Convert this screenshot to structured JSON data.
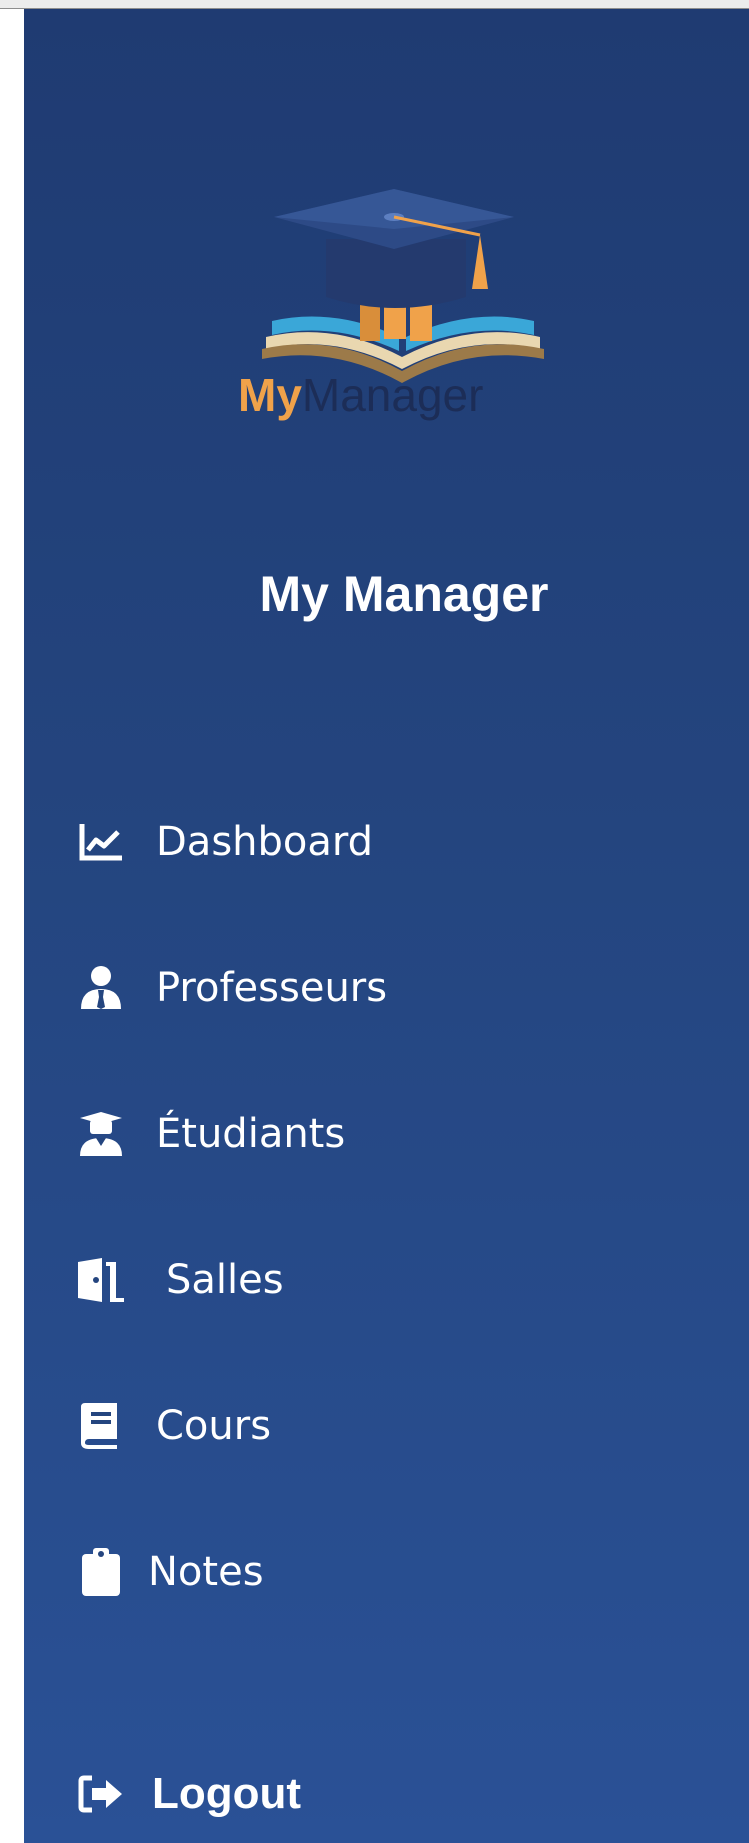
{
  "brand": {
    "logo_text_part1": "My",
    "logo_text_part2": "Manager",
    "title": "My Manager"
  },
  "nav": {
    "items": [
      {
        "label": "Dashboard",
        "icon": "chart-line-icon"
      },
      {
        "label": "Professeurs",
        "icon": "user-tie-icon"
      },
      {
        "label": "Étudiants",
        "icon": "user-graduate-icon"
      },
      {
        "label": "Salles",
        "icon": "door-open-icon"
      },
      {
        "label": "Cours",
        "icon": "book-icon"
      },
      {
        "label": "Notes",
        "icon": "clipboard-icon"
      }
    ],
    "logout_label": "Logout"
  },
  "colors": {
    "sidebar_top": "#1f3b72",
    "sidebar_bottom": "#2a5196",
    "logo_orange": "#f0a24a",
    "logo_dark": "#1c2d57",
    "logo_blue": "#3aa7d8"
  }
}
